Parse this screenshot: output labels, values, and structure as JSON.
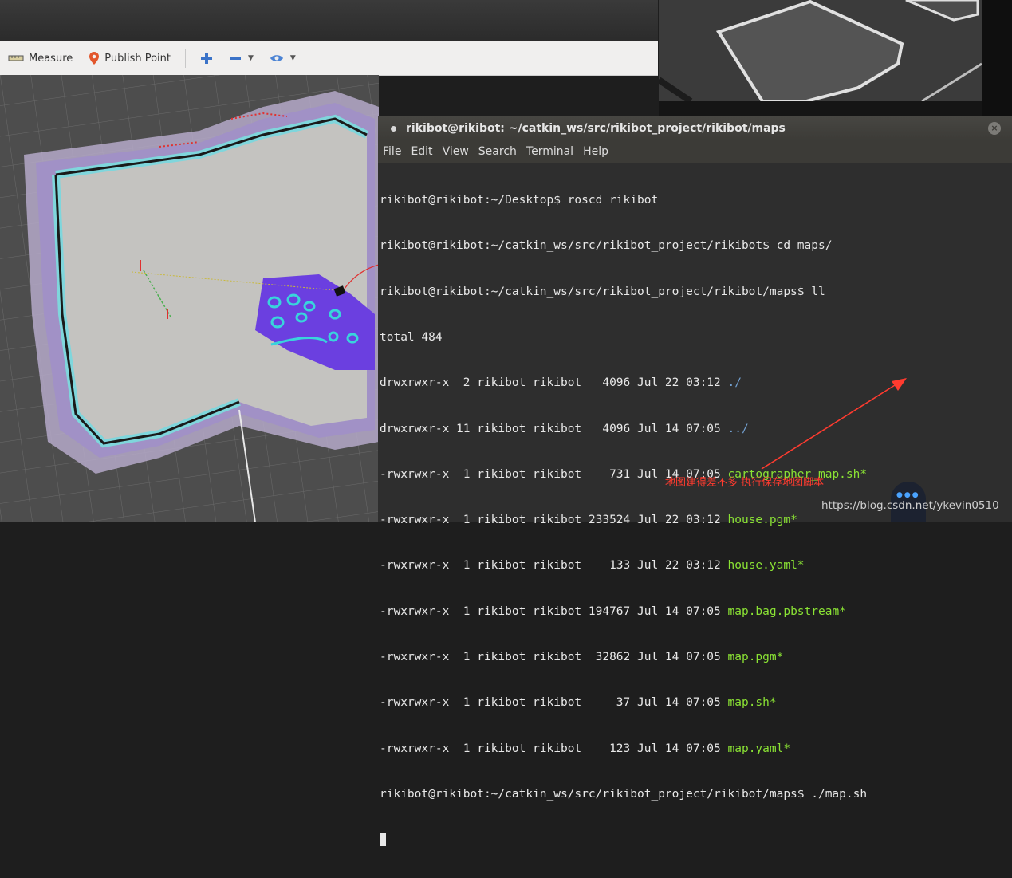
{
  "toolbar": {
    "measure_label": "Measure",
    "publish_point_label": "Publish Point"
  },
  "colors": {
    "terminal_bg": "#2e2e2e",
    "executable": "#8ae234",
    "directory": "#729fcf",
    "annotation": "#ff3b2f"
  },
  "terminal": {
    "title": "rikibot@rikibot: ~/catkin_ws/src/rikibot_project/rikibot/maps",
    "menu": [
      "File",
      "Edit",
      "View",
      "Search",
      "Terminal",
      "Help"
    ],
    "commands": {
      "c1": "rikibot@rikibot:~/Desktop$ roscd rikibot",
      "c2": "rikibot@rikibot:~/catkin_ws/src/rikibot_project/rikibot$ cd maps/",
      "c3": "rikibot@rikibot:~/catkin_ws/src/rikibot_project/rikibot/maps$ ll",
      "total": "total 484",
      "prompt_last": "rikibot@rikibot:~/catkin_ws/src/rikibot_project/rikibot/maps$ ./map.sh"
    },
    "listing": [
      {
        "perm": "drwxrwxr-x  2 rikibot rikibot   4096 Jul 22 03:12 ",
        "name": "./",
        "kind": "dir"
      },
      {
        "perm": "drwxrwxr-x 11 rikibot rikibot   4096 Jul 14 07:05 ",
        "name": "../",
        "kind": "dir"
      },
      {
        "perm": "-rwxrwxr-x  1 rikibot rikibot    731 Jul 14 07:05 ",
        "name": "cartographer_map.sh*",
        "kind": "exe"
      },
      {
        "perm": "-rwxrwxr-x  1 rikibot rikibot 233524 Jul 22 03:12 ",
        "name": "house.pgm*",
        "kind": "exe"
      },
      {
        "perm": "-rwxrwxr-x  1 rikibot rikibot    133 Jul 22 03:12 ",
        "name": "house.yaml*",
        "kind": "exe"
      },
      {
        "perm": "-rwxrwxr-x  1 rikibot rikibot 194767 Jul 14 07:05 ",
        "name": "map.bag.pbstream*",
        "kind": "exe"
      },
      {
        "perm": "-rwxrwxr-x  1 rikibot rikibot  32862 Jul 14 07:05 ",
        "name": "map.pgm*",
        "kind": "exe"
      },
      {
        "perm": "-rwxrwxr-x  1 rikibot rikibot     37 Jul 14 07:05 ",
        "name": "map.sh*",
        "kind": "exe"
      },
      {
        "perm": "-rwxrwxr-x  1 rikibot rikibot    123 Jul 14 07:05 ",
        "name": "map.yaml*",
        "kind": "exe"
      }
    ]
  },
  "annotation": {
    "text": "地图建得差不多 执行保存地图脚本"
  },
  "watermark": {
    "text": "https://blog.csdn.net/ykevin0510"
  }
}
